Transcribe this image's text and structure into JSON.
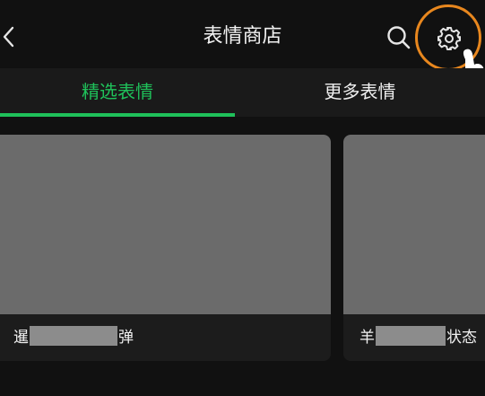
{
  "header": {
    "title": "表情商店",
    "icons": {
      "back": "chevron-left-icon",
      "search": "search-icon",
      "settings": "gear-icon",
      "pointer": "hand-pointer-icon"
    },
    "highlight_color": "#e8871e"
  },
  "tabs": [
    {
      "label": "精选表情",
      "active": true
    },
    {
      "label": "更多表情",
      "active": false
    }
  ],
  "accent_color": "#1fc15a",
  "cards": [
    {
      "label_start": "暹",
      "label_end": "弹"
    },
    {
      "label_start": "羊",
      "label_end": "状态"
    }
  ]
}
